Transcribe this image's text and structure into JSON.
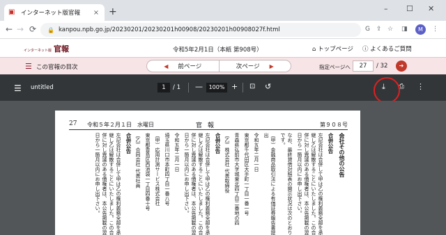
{
  "browser": {
    "tab_title": "インターネット版官報",
    "tab_close": "×",
    "new_tab": "+",
    "window_controls": [
      "–",
      "☐",
      "✕"
    ],
    "back": "←",
    "forward": "→",
    "reload": "C",
    "url": "kanpou.npb.go.jp/20230201/20230201h00908/20230201h00908027f.html",
    "profile_initial": "M"
  },
  "site": {
    "logo_small": "インターネット版",
    "logo_main": "官報",
    "issue_line": "令和5年2月1日（本紙 第908号）",
    "top_page": "トップページ",
    "faq": "よくあるご質問"
  },
  "nav": {
    "toc_label": "この官報の目次",
    "prev_label": "前ページ",
    "next_label": "次ページ",
    "jump_label": "指定ページへ",
    "page_value": "27",
    "page_total": "/ 32"
  },
  "pdf_toolbar": {
    "filename": "untitled",
    "page_current": "1",
    "page_of": "/  1",
    "zoom": "100%"
  },
  "document": {
    "page_number": "27",
    "date": "令和５年２月１日　水曜日",
    "paper_title": "官報",
    "issue_no": "第９０８号",
    "columns": [
      {
        "kind": "section",
        "text": "会社その他の公告"
      },
      {
        "kind": "head",
        "text": "合併公告"
      },
      {
        "kind": "body",
        "text": "左記会社は合併して甲は乙の権利義務全部を承継し乙は解散することにいたしました。この合併に対し異議のある債権者は、本公告掲載の翌日から一箇月以内にお申し出下さい。"
      },
      {
        "kind": "body",
        "text": "なお、最終貸借対照表の開示状況は次のとおりです。"
      },
      {
        "kind": "body",
        "text": "（甲）金融商品取引法による有価証券報告書提出"
      },
      {
        "kind": "body",
        "text": "令和五年二月一日"
      },
      {
        "kind": "body",
        "text": "東京都千代田区大手町一丁目一番一号"
      },
      {
        "kind": "body",
        "text": "青森県弘前市大字城東北四丁目二番地の四"
      },
      {
        "kind": "body",
        "text": "（乙）株式会社 代表取締役"
      },
      {
        "kind": "head",
        "text": "合併公告"
      },
      {
        "kind": "body",
        "text": "左記会社は合併して甲は乙の権利義務全部を承継し乙は解散することにいたしました。この合併に対し異議のある債権者は、本公告掲載の翌日から一箇月以内にお申し出下さい。"
      },
      {
        "kind": "body",
        "text": "令和五年二月一日"
      },
      {
        "kind": "body",
        "text": "埼玉県川口市本町四丁目一番八号"
      },
      {
        "kind": "body",
        "text": "（甲）応用計測サービス株式会社"
      },
      {
        "kind": "body",
        "text": "東京都豊島区西池袋一丁目四番十号"
      },
      {
        "kind": "body",
        "text": "（乙）合同会社 代表社員"
      },
      {
        "kind": "head",
        "text": "合併公告"
      },
      {
        "kind": "body",
        "text": "左記会社は合併して甲は乙の権利義務全部を承継し乙は解散することにいたしました。この合併に対し異議のある債権者は、本公告掲載の翌日から一箇月以内にお申し出下さい。"
      }
    ]
  },
  "icons": {
    "favicon": "kanpou-favicon",
    "lock": "lock-icon",
    "download": "download-icon",
    "print": "print-icon"
  },
  "colors": {
    "accent": "#c0392b",
    "pink_bar": "#f7e4e6",
    "pdf_toolbar": "#323639",
    "viewer_bg": "#525659",
    "highlight_ring": "#e02020"
  }
}
